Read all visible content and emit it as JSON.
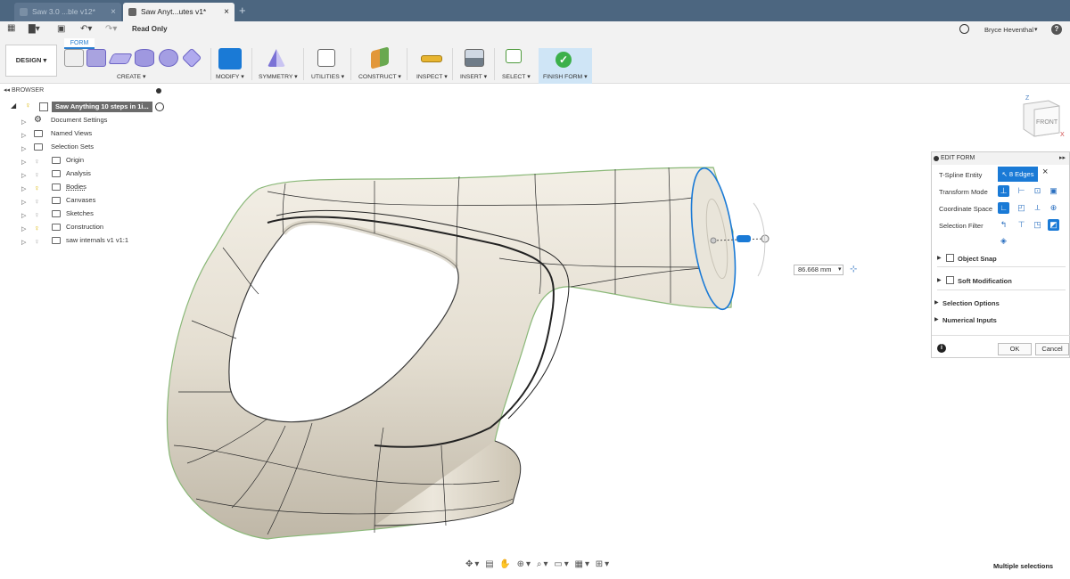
{
  "tabs": [
    {
      "label": "Saw 3.0 ...ble v12*"
    },
    {
      "label": "Saw Anyt...utes v1*"
    }
  ],
  "toolbar": {
    "status": "Read Only",
    "user": "Bryce Heventhal"
  },
  "ribbon": {
    "workspace_tab": "FORM",
    "workspace": "DESIGN",
    "groups": [
      "CREATE",
      "MODIFY",
      "SYMMETRY",
      "UTILITIES",
      "CONSTRUCT",
      "INSPECT",
      "INSERT",
      "SELECT",
      "FINISH FORM"
    ]
  },
  "browser": {
    "title": "BROWSER",
    "root": "Saw Anything 10 steps in 1i...",
    "items": [
      "Document Settings",
      "Named Views",
      "Selection Sets",
      "Origin",
      "Analysis",
      "Bodies",
      "Canvases",
      "Sketches",
      "Construction",
      "saw internals v1 v1:1"
    ]
  },
  "dimension": {
    "value": "86.668 mm"
  },
  "viewcube": {
    "face": "FRONT",
    "axis_z": "Z",
    "axis_x": "X"
  },
  "edit_form": {
    "title": "EDIT FORM",
    "tspline_label": "T-Spline Entity",
    "selection_badge": "8 Edges",
    "transform_label": "Transform Mode",
    "coord_label": "Coordinate Space",
    "filter_label": "Selection Filter",
    "object_snap": "Object Snap",
    "soft_mod": "Soft Modification",
    "selection_options": "Selection Options",
    "numerical_inputs": "Numerical Inputs",
    "ok": "OK",
    "cancel": "Cancel"
  },
  "status_bar": {
    "text": "Multiple selections"
  },
  "colors": {
    "accent": "#1a7ad6",
    "titlebar": "#4c6680",
    "finish": "#3cb04a",
    "model": "#e3ddd0"
  }
}
